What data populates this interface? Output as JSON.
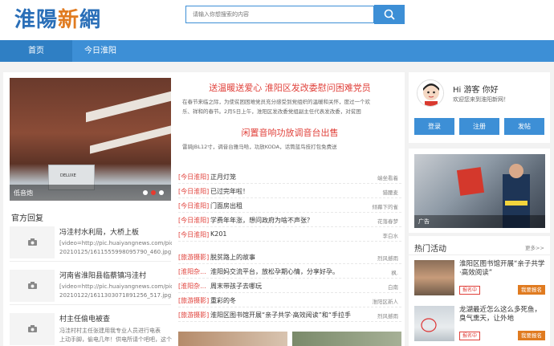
{
  "logo": {
    "part1": "淮陽",
    "part2": "新",
    "part3": "網"
  },
  "search": {
    "placeholder": "请输入你想搜索的内容"
  },
  "nav": {
    "items": [
      {
        "label": "首页"
      },
      {
        "label": "今日淮阳"
      }
    ]
  },
  "slider": {
    "caption": "低音炮",
    "box_text": "DELUXE"
  },
  "replies": {
    "title": "官方回复",
    "items": [
      {
        "title": "冯洼村水利局，大桥上板",
        "snippet1": "[video=http://pic.huaiyangnews.com/pic/",
        "snippet2": "20210125/1611555998095790_460.jpg]ht"
      },
      {
        "title": "河南省淮阳县临蔡镇冯洼村",
        "snippet1": "[video=http://pic.huaiyangnews.com/pic/",
        "snippet2": "20210122/1611303071891256_517.jpg]ht"
      },
      {
        "title": "村主任偷电被查",
        "snippet1": "冯洼村村主任张建用我专业人员进行电表",
        "snippet2": "上动手脚，偷电几年！供电所请个吧吧，这个"
      }
    ]
  },
  "headlines": [
    {
      "title": "送温暖送爱心 淮阳区发改委慰问困难党员",
      "lead1": "在春节来临之际，为使贫困困难党员充分感受到党组织的温暖和关怀，度过一个欢",
      "lead2": "乐、祥和的春节。2月5日上午，淮阳区发改委党组副主任代表发改委，对贫困"
    },
    {
      "title": "闲置音响功放调音台出售",
      "lead1": "雷骑JBL12寸，调音台雅马哈，功放KODA，话筒蓝鸟技打包免费送",
      "lead2": ""
    }
  ],
  "news": [
    {
      "tag": "[今日淮阳]",
      "title": "正月灯笼",
      "author": "端坐看着"
    },
    {
      "tag": "[今日淮阳]",
      "title": "已过完年啦！",
      "author": "猎腰麦"
    },
    {
      "tag": "[今日淮阳]",
      "title": "门面房出租",
      "author": "倾幕下的雀"
    },
    {
      "tag": "[今日淮阳]",
      "title": "学费年年涨，想问政府为啥不声张？",
      "author": "花落春梦"
    },
    {
      "tag": "[今日淮阳]",
      "title": "K201",
      "author": "李白水"
    },
    {
      "tag": "[旅游摄影]",
      "title": "脱贫路上的故事",
      "author": "烈风撼雨"
    },
    {
      "tag": "[淮阳杂...",
      "title": "淮阳妈交流平台，放松孕期心情，分享好孕。",
      "author": "枫."
    },
    {
      "tag": "[淮阳杂...",
      "title": "周末带孩子去哪玩",
      "author": "白南"
    },
    {
      "tag": "[旅游摄影]",
      "title": "重彩的冬",
      "author": "淮阳区新人"
    },
    {
      "tag": "[旅游摄影]",
      "title": "淮阳区图书馆开展“亲子共学·高效阅读”和“手拉手",
      "author": "烈风撼雨"
    }
  ],
  "user": {
    "greeting": "Hi 游客 你好",
    "welcome": "欢迎您来到淮阳新网！",
    "login": "登录",
    "register": "注册",
    "post": "发帖"
  },
  "ad": {
    "label": "广告"
  },
  "hot": {
    "title": "热门活动",
    "more": "更多>>",
    "items": [
      {
        "title": "淮阳区图书馆开展“亲子共学·高效阅读”",
        "status": "报名中",
        "action": "我要报名"
      },
      {
        "title": "龙湖最近怎么这么多死鱼，臭气熏天，让外地",
        "status": "报名中",
        "action": "我要报名"
      }
    ]
  },
  "colors": {
    "primary": "#3d8fd6",
    "accent_red": "#e0403a",
    "accent_orange": "#e07b20"
  }
}
